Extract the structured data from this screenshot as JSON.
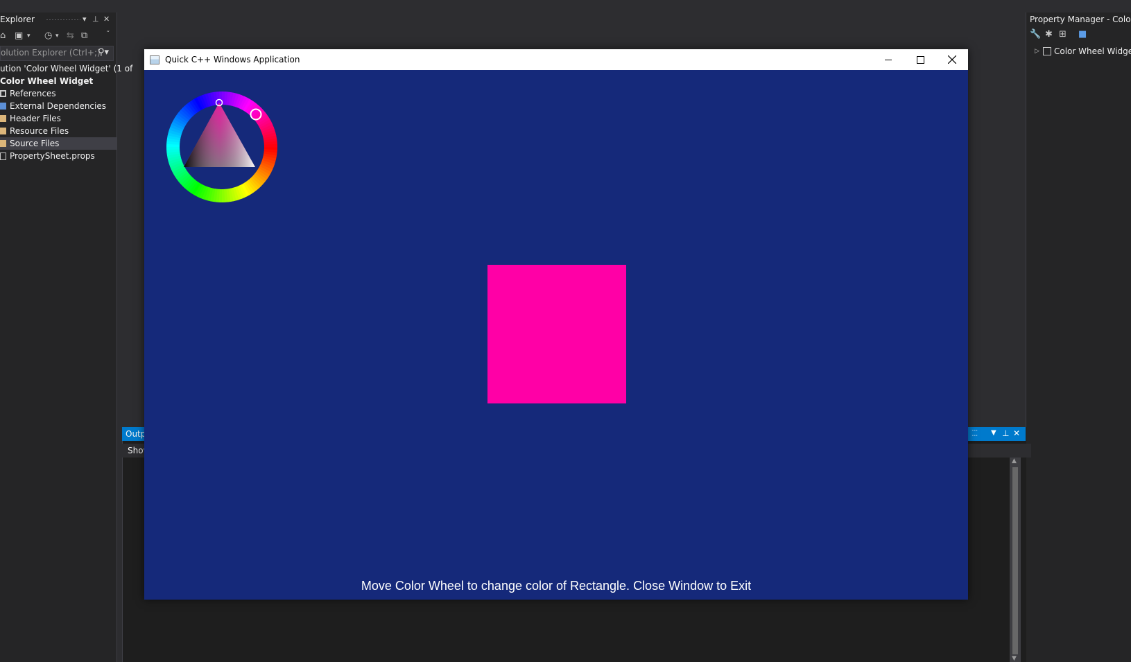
{
  "solution_explorer": {
    "title": "Explorer",
    "search_placeholder": "olution Explorer (Ctrl+;)",
    "solution_label": "ution 'Color Wheel Widget' (1 of",
    "project_label": "Color Wheel Widget",
    "items": [
      {
        "label": "References",
        "icon": "references-icon"
      },
      {
        "label": "External Dependencies",
        "icon": "external-deps-icon"
      },
      {
        "label": "Header Files",
        "icon": "folder-icon"
      },
      {
        "label": "Resource Files",
        "icon": "folder-icon"
      },
      {
        "label": "Source Files",
        "icon": "folder-icon",
        "selected": true
      },
      {
        "label": "PropertySheet.props",
        "icon": "file-icon"
      }
    ]
  },
  "property_manager": {
    "title": "Property Manager - Color W",
    "item_label": "Color Wheel Widget"
  },
  "output": {
    "tab_label": "Outp",
    "show_label": "Shov"
  },
  "app_window": {
    "title": "Quick C++ Windows Application",
    "background_color": "#15297a",
    "rect_color": "#ff00a6",
    "message": "Move Color Wheel to change color of Rectangle. Close Window to Exit",
    "hue_selector_color": "#ff00a6"
  },
  "colors": {
    "ide_bg": "#2d2d30",
    "panel_bg": "#252526",
    "accent": "#007acc"
  }
}
